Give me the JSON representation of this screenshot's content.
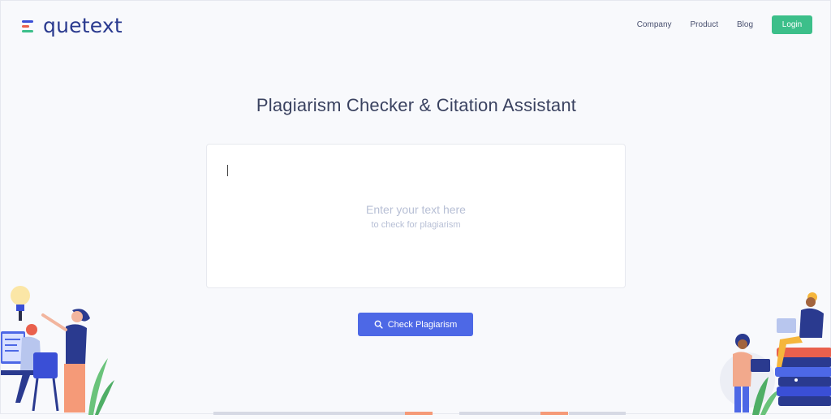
{
  "header": {
    "logo_text": "quetext",
    "nav": [
      "Company",
      "Product",
      "Blog"
    ],
    "login_label": "Login"
  },
  "main": {
    "title": "Plagiarism Checker & Citation Assistant",
    "placeholder_line1": "Enter your text here",
    "placeholder_line2": "to check for plagiarism",
    "check_button_label": "Check Plagiarism"
  },
  "icons": {
    "search": "search-icon",
    "logo": "quetext-logo-icon"
  },
  "colors": {
    "accent": "#4d68e6",
    "login": "#3cbf8a",
    "brand": "#2a3a8f"
  }
}
